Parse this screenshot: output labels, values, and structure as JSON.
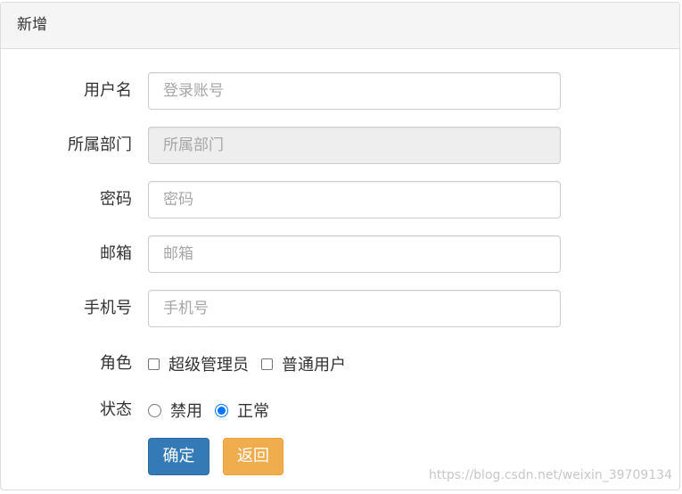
{
  "panel": {
    "title": "新增"
  },
  "form": {
    "username": {
      "label": "用户名",
      "placeholder": "登录账号",
      "value": ""
    },
    "department": {
      "label": "所属部门",
      "placeholder": "所属部门",
      "value": "",
      "disabled": true
    },
    "password": {
      "label": "密码",
      "placeholder": "密码",
      "value": ""
    },
    "email": {
      "label": "邮箱",
      "placeholder": "邮箱",
      "value": ""
    },
    "phone": {
      "label": "手机号",
      "placeholder": "手机号",
      "value": ""
    },
    "role": {
      "label": "角色",
      "options": [
        {
          "label": "超级管理员",
          "checked": false
        },
        {
          "label": "普通用户",
          "checked": false
        }
      ]
    },
    "status": {
      "label": "状态",
      "options": [
        {
          "label": "禁用",
          "checked": false
        },
        {
          "label": "正常",
          "checked": true
        }
      ]
    },
    "buttons": {
      "confirm": "确定",
      "back": "返回"
    }
  },
  "watermark": "https://blog.csdn.net/weixin_39709134",
  "colors": {
    "primary": "#337ab7",
    "warning": "#f0ad4e",
    "radio_accent": "#0075ff"
  }
}
